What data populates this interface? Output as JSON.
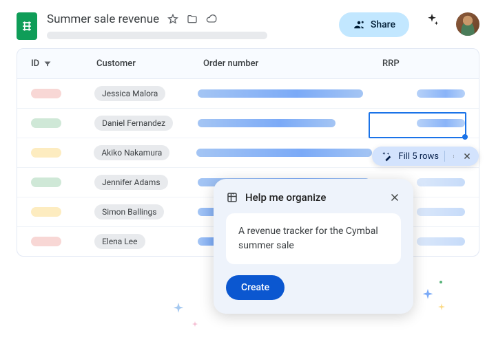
{
  "header": {
    "doc_title": "Summer sale revenue",
    "share_label": "Share"
  },
  "table": {
    "columns": {
      "id": "ID",
      "customer": "Customer",
      "order": "Order number",
      "rrp": "RRP"
    },
    "rows": [
      {
        "id_color": "id-red",
        "customer": "Jessica Malora",
        "order_w": 240,
        "rrp_fade": false
      },
      {
        "id_color": "id-green",
        "customer": "Daniel Fernandez",
        "order_w": 200,
        "rrp_fade": false
      },
      {
        "id_color": "id-yellow",
        "customer": "Akiko Nakamura",
        "order_w": 255,
        "rrp_fade": true
      },
      {
        "id_color": "id-green",
        "customer": "Jennifer Adams",
        "order_w": 250,
        "rrp_fade": true
      },
      {
        "id_color": "id-yellow",
        "customer": "Simon Ballings",
        "order_w": 60,
        "rrp_fade": true
      },
      {
        "id_color": "id-red",
        "customer": "Elena Lee",
        "order_w": 40,
        "rrp_fade": true
      }
    ]
  },
  "fill_suggestion": {
    "label": "Fill 5 rows"
  },
  "panel": {
    "title": "Help me organize",
    "prompt": "A revenue tracker for the Cymbal summer sale",
    "create_label": "Create"
  }
}
